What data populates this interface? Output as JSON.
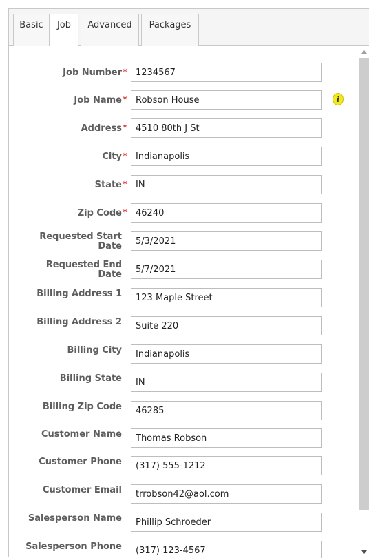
{
  "tabs": [
    {
      "label": "Basic"
    },
    {
      "label": "Job"
    },
    {
      "label": "Advanced"
    },
    {
      "label": "Packages"
    }
  ],
  "active_tab": "Job",
  "info_icon": {
    "glyph": "i"
  },
  "required_marker": "*",
  "fields": {
    "job_number": {
      "label": "Job Number",
      "value": "1234567"
    },
    "job_name": {
      "label": "Job Name",
      "value": "Robson House"
    },
    "address": {
      "label": "Address",
      "value": "4510 80th J St"
    },
    "city": {
      "label": "City",
      "value": "Indianapolis"
    },
    "state": {
      "label": "State",
      "value": "IN"
    },
    "zip_code": {
      "label": "Zip Code",
      "value": "46240"
    },
    "requested_start_date": {
      "label_line1": "Requested Start",
      "label_line2": "Date",
      "value": "5/3/2021"
    },
    "requested_end_date": {
      "label_line1": "Requested End",
      "label_line2": "Date",
      "value": "5/7/2021"
    },
    "billing_address_1": {
      "label": "Billing Address 1",
      "value": "123 Maple Street"
    },
    "billing_address_2": {
      "label": "Billing Address 2",
      "value": "Suite 220"
    },
    "billing_city": {
      "label": "Billing City",
      "value": "Indianapolis"
    },
    "billing_state": {
      "label": "Billing State",
      "value": "IN"
    },
    "billing_zip_code": {
      "label": "Billing Zip Code",
      "value": "46285"
    },
    "customer_name": {
      "label": "Customer Name",
      "value": "Thomas Robson"
    },
    "customer_phone": {
      "label": "Customer Phone",
      "value": "(317) 555-1212"
    },
    "customer_email": {
      "label": "Customer Email",
      "value": "trrobson42@aol.com"
    },
    "salesperson_name": {
      "label": "Salesperson Name",
      "value": "Phillip Schroeder"
    },
    "salesperson_phone": {
      "label": "Salesperson Phone",
      "value": "(317) 123-4567"
    }
  },
  "colors": {
    "required": "#e0403a",
    "label": "#5e5e5e",
    "info_icon": "#f2ea1d"
  }
}
